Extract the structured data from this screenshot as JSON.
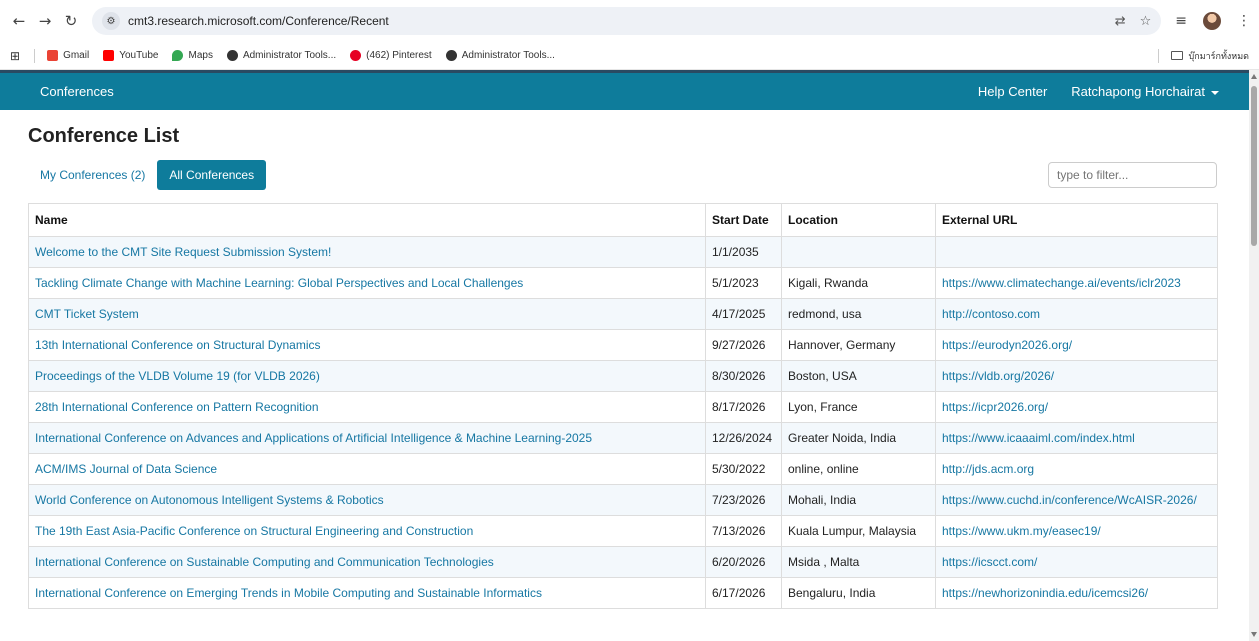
{
  "browser": {
    "url": "cmt3.research.microsoft.com/Conference/Recent",
    "bookmarks": [
      {
        "label": "Gmail",
        "color": "#ea4335"
      },
      {
        "label": "YouTube",
        "color": "#ff0000"
      },
      {
        "label": "Maps",
        "color": "#34a853"
      },
      {
        "label": "Administrator Tools...",
        "color": "#333333"
      },
      {
        "label": "(462) Pinterest",
        "color": "#e60023"
      },
      {
        "label": "Administrator Tools...",
        "color": "#333333"
      }
    ],
    "all_bookmarks_label": "บุ๊กมาร์กทั้งหมด"
  },
  "topnav": {
    "brand": "Conferences",
    "help": "Help Center",
    "user": "Ratchapong Horchairat"
  },
  "page": {
    "title": "Conference List",
    "tab_mine": "My Conferences (2)",
    "tab_all": "All Conferences",
    "filter_placeholder": "type to filter..."
  },
  "table": {
    "headers": [
      "Name",
      "Start Date",
      "Location",
      "External URL"
    ],
    "rows": [
      {
        "name": "Welcome to the CMT Site Request Submission System!",
        "date": "1/1/2035",
        "location": "",
        "url": ""
      },
      {
        "name": "Tackling Climate Change with Machine Learning: Global Perspectives and Local Challenges",
        "date": "5/1/2023",
        "location": "Kigali, Rwanda",
        "url": "https://www.climatechange.ai/events/iclr2023"
      },
      {
        "name": "CMT Ticket System",
        "date": "4/17/2025",
        "location": "redmond, usa",
        "url": "http://contoso.com"
      },
      {
        "name": "13th International Conference on Structural Dynamics",
        "date": "9/27/2026",
        "location": "Hannover, Germany",
        "url": "https://eurodyn2026.org/"
      },
      {
        "name": "Proceedings of the VLDB Volume 19 (for VLDB 2026)",
        "date": "8/30/2026",
        "location": "Boston, USA",
        "url": "https://vldb.org/2026/"
      },
      {
        "name": "28th International Conference on Pattern Recognition",
        "date": "8/17/2026",
        "location": "Lyon, France",
        "url": "https://icpr2026.org/"
      },
      {
        "name": "International Conference on Advances and Applications of Artificial Intelligence & Machine Learning-2025",
        "date": "12/26/2024",
        "location": "Greater Noida, India",
        "url": "https://www.icaaaiml.com/index.html"
      },
      {
        "name": "ACM/IMS Journal of Data Science",
        "date": "5/30/2022",
        "location": "online, online",
        "url": "http://jds.acm.org"
      },
      {
        "name": "World Conference on Autonomous Intelligent Systems & Robotics",
        "date": "7/23/2026",
        "location": "Mohali, India",
        "url": "https://www.cuchd.in/conference/WcAISR-2026/"
      },
      {
        "name": "The 19th East Asia-Pacific Conference on Structural Engineering and Construction",
        "date": "7/13/2026",
        "location": "Kuala Lumpur, Malaysia",
        "url": "https://www.ukm.my/easec19/"
      },
      {
        "name": "International Conference on Sustainable Computing and Communication Technologies",
        "date": "6/20/2026",
        "location": "Msida , Malta",
        "url": "https://icscct.com/"
      },
      {
        "name": "International Conference on Emerging Trends in Mobile Computing and Sustainable Informatics",
        "date": "6/17/2026",
        "location": "Bengaluru, India",
        "url": "https://newhorizonindia.edu/icemcsi26/"
      }
    ]
  },
  "colors": {
    "accent": "#0e7c9b",
    "link": "#1677a3",
    "row_alt": "#f3f8fc"
  }
}
